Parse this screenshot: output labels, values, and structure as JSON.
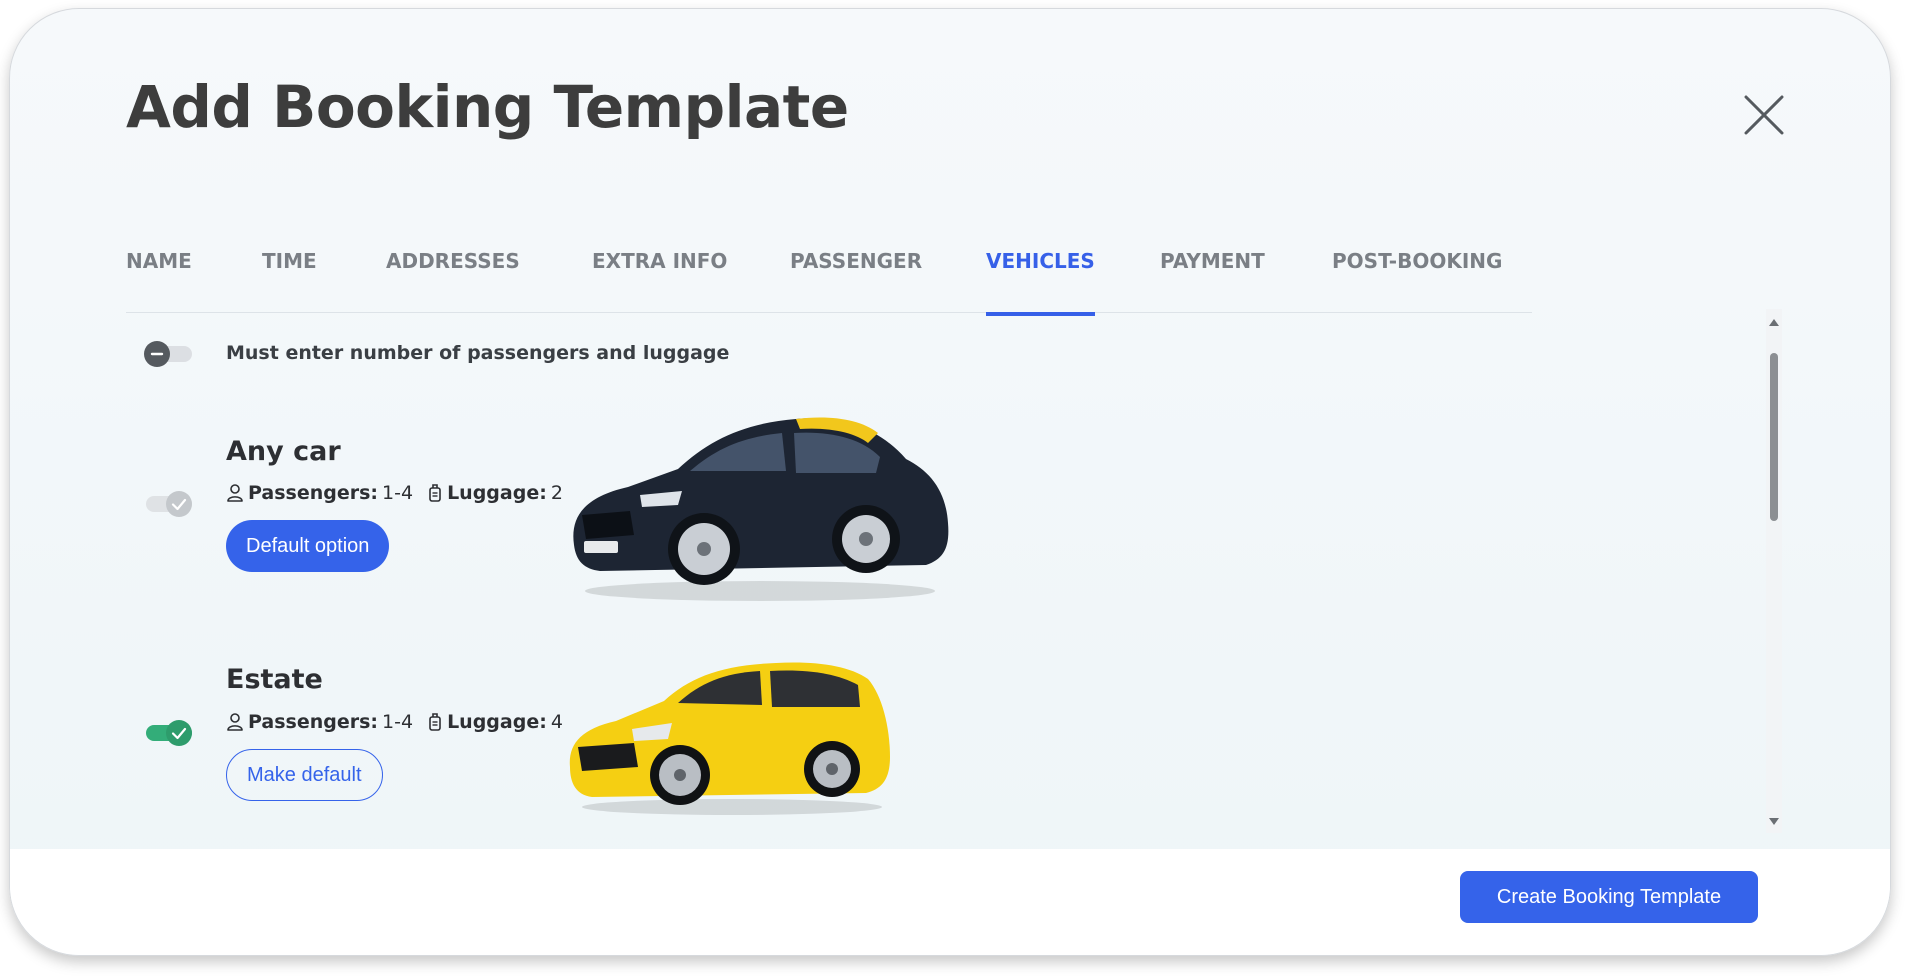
{
  "modal": {
    "title": "Add Booking Template",
    "create_button": "Create Booking Template"
  },
  "tabs": [
    {
      "label": "NAME",
      "active": false
    },
    {
      "label": "TIME",
      "active": false
    },
    {
      "label": "ADDRESSES",
      "active": false
    },
    {
      "label": "EXTRA INFO",
      "active": false
    },
    {
      "label": "PASSENGER",
      "active": false
    },
    {
      "label": "VEHICLES",
      "active": true
    },
    {
      "label": "PAYMENT",
      "active": false
    },
    {
      "label": "POST-BOOKING",
      "active": false
    }
  ],
  "requirement": {
    "label": "Must enter number of passengers and luggage",
    "enabled": false
  },
  "vehicles": [
    {
      "name": "Any car",
      "passengers_label": "Passengers:",
      "passengers": "1-4",
      "luggage_label": "Luggage:",
      "luggage": "2",
      "button": "Default option",
      "selected": true,
      "toggle_disabled": true,
      "color": "#1d2533",
      "roof_color": "#f2c71c"
    },
    {
      "name": "Estate",
      "passengers_label": "Passengers:",
      "passengers": "1-4",
      "luggage_label": "Luggage:",
      "luggage": "4",
      "button": "Make default",
      "selected": true,
      "toggle_disabled": false,
      "color": "#f5cf12"
    }
  ],
  "colors": {
    "accent": "#3563ea",
    "toggle_on": "#33ad79",
    "title": "#3d3d3d"
  }
}
